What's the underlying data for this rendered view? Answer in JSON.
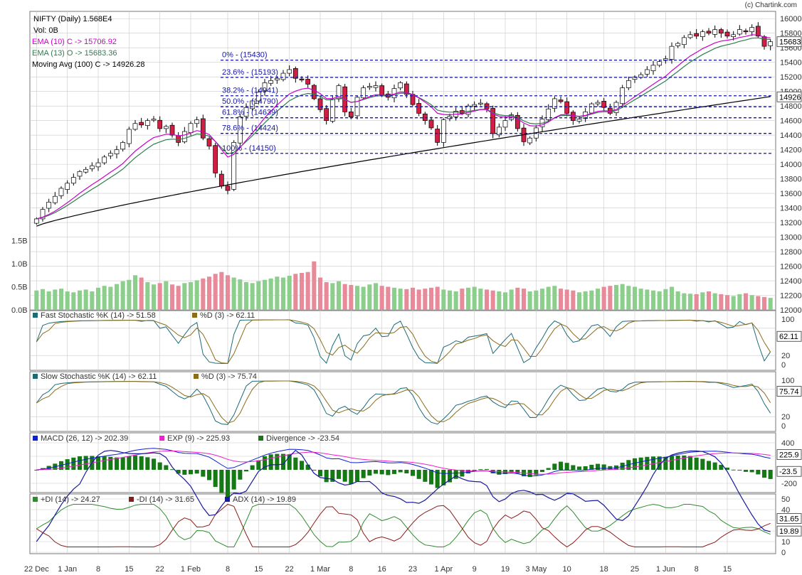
{
  "copyright": "(c) Chartink.com",
  "colors": {
    "up": "#ffffff",
    "down": "#d01f45",
    "up_vol": "#8ccf8c",
    "down_vol": "#e88a9a",
    "ema10": "#cc00cc",
    "ema13": "#2e7d4f",
    "ma100": "#000000",
    "fib": "#1515aa",
    "grid": "#c9c9c9",
    "panel_border": "#777777",
    "stoch_k": "#1b6b77",
    "stoch_d": "#8a6d1a",
    "macd": "#1020d0",
    "macd_sig": "#ee22cc",
    "macd_div": "#157a15",
    "di_plus": "#2e8b2e",
    "di_minus": "#8b1a1a",
    "adx": "#1a1a9e"
  },
  "main_legend": {
    "title": "NIFTY (Daily) 1.568E4",
    "vol": "Vol: 0B",
    "ema10": "EMA (10) C -> 15706.92",
    "ema13": "EMA (13) O -> 15683.36",
    "ma100": "Moving Avg (100) C -> 14926.28"
  },
  "main_axis": {
    "ticks": [
      "16000",
      "15800",
      "15600",
      "15400",
      "15200",
      "15000",
      "14800",
      "14600",
      "14400",
      "14200",
      "14000",
      "13800",
      "13600",
      "13400",
      "13200",
      "13000",
      "12800",
      "12600",
      "12400",
      "12200",
      "12000"
    ],
    "price_tags": [
      "15683",
      "14926"
    ]
  },
  "volume_axis": {
    "ticks": [
      "1.5B",
      "1.0B",
      "0.5B",
      "0.0B"
    ]
  },
  "fib_labels": [
    "0% - (15430)",
    "23.6% - (15193)",
    "38.2% - (14941)",
    "50.0% - (14790)",
    "61.8% - (14639)",
    "78.6% - (14424)",
    "100% - (14150)"
  ],
  "x_labels": [
    "22 Dec",
    "1 Jan",
    "8",
    "15",
    "22",
    "1 Feb",
    "8",
    "15",
    "22",
    "1 Mar",
    "8",
    "16",
    "23",
    "1 Apr",
    "9",
    "19",
    "3 May",
    "10",
    "18",
    "25",
    "1 Jun",
    "8",
    "15"
  ],
  "fast_stoch": {
    "k_label": "Fast Stochastic %K (14) -> 51.58",
    "d_label": "%D (3) -> 62.11",
    "ticks": [
      "100",
      "20",
      "0"
    ],
    "tags": [
      "62.11"
    ]
  },
  "slow_stoch": {
    "k_label": "Slow Stochastic %K (14) -> 62.11",
    "d_label": "%D (3) -> 75.74",
    "ticks": [
      "100",
      "20",
      "0"
    ],
    "tags": [
      "75.74"
    ]
  },
  "macd": {
    "macd_label": "MACD (26, 12) -> 202.39",
    "exp_label": "EXP (9) -> 225.93",
    "div_label": "Divergence -> -23.54",
    "ticks": [
      "400",
      "200",
      "-200"
    ],
    "tags": [
      "225.9",
      "-23.5"
    ]
  },
  "dmi": {
    "plus_label": "+DI (14) -> 24.27",
    "minus_label": "-DI (14) -> 31.65",
    "adx_label": "ADX (14) -> 19.89",
    "ticks": [
      "50",
      "40",
      "30",
      "20",
      "10",
      "0"
    ],
    "tags": [
      "31.65",
      "19.89"
    ]
  },
  "chart_data": {
    "type": "candlestick",
    "title": "NIFTY (Daily) 1.568E4",
    "ylim": [
      12000,
      16100
    ],
    "fib_levels": [
      15430,
      15193,
      14941,
      14790,
      14639,
      14424,
      14150
    ],
    "close": [
      13250,
      13380,
      13480,
      13560,
      13670,
      13740,
      13820,
      13900,
      13930,
      13980,
      14020,
      14100,
      14150,
      14200,
      14300,
      14480,
      14560,
      14540,
      14600,
      14620,
      14490,
      14520,
      14400,
      14300,
      14450,
      14560,
      14610,
      14360,
      14250,
      13880,
      13700,
      13640,
      14300,
      14650,
      14780,
      14870,
      14990,
      15120,
      15150,
      15180,
      15250,
      15300,
      15180,
      15160,
      15100,
      14900,
      14750,
      14600,
      14890,
      15080,
      14720,
      14650,
      14920,
      15050,
      15070,
      15080,
      14950,
      14920,
      15040,
      15120,
      14960,
      14820,
      14700,
      14600,
      14500,
      14300,
      14610,
      14660,
      14730,
      14700,
      14800,
      14820,
      14840,
      14760,
      14420,
      14510,
      14600,
      14680,
      14490,
      14310,
      14360,
      14500,
      14620,
      14760,
      14900,
      14860,
      14700,
      14600,
      14620,
      14720,
      14830,
      14850,
      14780,
      14700,
      14850,
      15050,
      15150,
      15200,
      15230,
      15300,
      15360,
      15410,
      15450,
      15620,
      15660,
      15740,
      15780,
      15760,
      15820,
      15800,
      15850,
      15800,
      15760,
      15780,
      15850,
      15820,
      15880,
      15760,
      15620,
      15683
    ],
    "volume_b": [
      0.42,
      0.45,
      0.4,
      0.44,
      0.46,
      0.4,
      0.38,
      0.42,
      0.44,
      0.4,
      0.48,
      0.52,
      0.5,
      0.56,
      0.62,
      0.65,
      0.75,
      0.7,
      0.6,
      0.55,
      0.58,
      0.62,
      0.55,
      0.52,
      0.58,
      0.6,
      0.64,
      0.68,
      0.72,
      0.78,
      0.82,
      0.75,
      0.7,
      0.66,
      0.6,
      0.58,
      0.62,
      0.65,
      0.68,
      0.72,
      0.7,
      0.74,
      0.78,
      0.8,
      0.82,
      1.05,
      0.7,
      0.6,
      0.58,
      0.62,
      0.56,
      0.54,
      0.52,
      0.5,
      0.55,
      0.58,
      0.52,
      0.5,
      0.48,
      0.46,
      0.45,
      0.48,
      0.44,
      0.46,
      0.48,
      0.5,
      0.44,
      0.42,
      0.4,
      0.46,
      0.48,
      0.5,
      0.46,
      0.44,
      0.42,
      0.4,
      0.38,
      0.44,
      0.48,
      0.46,
      0.4,
      0.42,
      0.46,
      0.5,
      0.52,
      0.46,
      0.44,
      0.42,
      0.38,
      0.4,
      0.42,
      0.46,
      0.5,
      0.52,
      0.54,
      0.56,
      0.52,
      0.5,
      0.46,
      0.44,
      0.42,
      0.4,
      0.45,
      0.5,
      0.4,
      0.36,
      0.35,
      0.34,
      0.38,
      0.4,
      0.36,
      0.34,
      0.32,
      0.3,
      0.34,
      0.36,
      0.32,
      0.3,
      0.28,
      0.26
    ]
  }
}
